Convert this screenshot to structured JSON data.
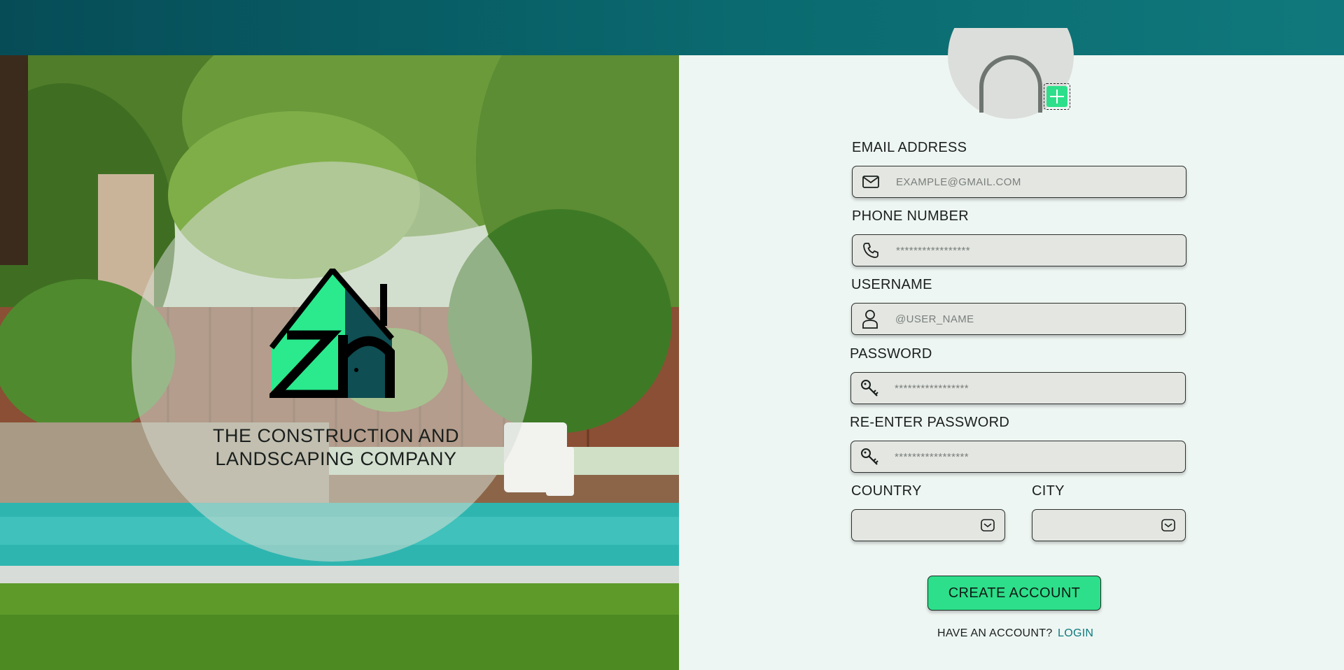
{
  "brand": {
    "company_line1": "THE CONSTRUCTION AND",
    "company_line2": "LANDSCAPING COMPANY",
    "logo_text": "zn"
  },
  "form": {
    "email": {
      "label": "EMAIL ADDRESS",
      "placeholder": "EXAMPLE@GMAIL.COM",
      "icon": "mail-icon"
    },
    "phone": {
      "label": "PHONE NUMBER",
      "placeholder": "*****************",
      "icon": "phone-icon"
    },
    "username": {
      "label": "USERNAME",
      "placeholder": "@USER_NAME",
      "icon": "user-icon"
    },
    "password": {
      "label": "PASSWORD",
      "placeholder": "*****************",
      "icon": "key-icon"
    },
    "repassword": {
      "label": "RE-ENTER PASSWORD",
      "placeholder": "*****************",
      "icon": "key-icon"
    },
    "country": {
      "label": "COUNTRY",
      "value": ""
    },
    "city": {
      "label": "CITY",
      "value": ""
    },
    "submit_label": "CREATE ACCOUNT",
    "have_account_text": "HAVE AN ACCOUNT?",
    "login_label": "LOGIN"
  },
  "colors": {
    "accent": "#2ddf8a",
    "topbar": "#0a6a6f",
    "link": "#0e7a7e"
  }
}
